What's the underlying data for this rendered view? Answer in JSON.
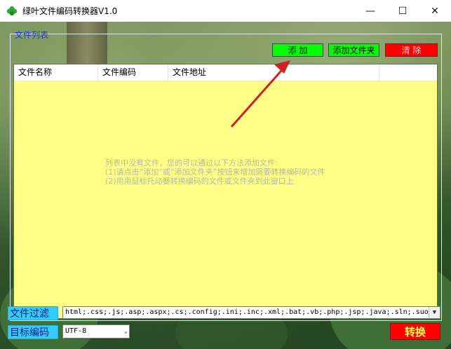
{
  "window": {
    "title": "绿叶文件编码转换器V1.0",
    "controls": {
      "minimize": "—",
      "maximize": "☐",
      "close": "✕"
    }
  },
  "file_list": {
    "group_label": "文件列表",
    "buttons": {
      "add": "添 加",
      "add_folder": "添加文件夹",
      "clear": "清 除"
    },
    "columns": [
      "文件名称",
      "文件编码",
      "文件地址",
      ""
    ],
    "empty_hint": [
      "列表中没有文件，您的可以通过以下方法添加文件:",
      "(1)请点击“添加”或“添加文件夹”按钮来增加需要转换编码的文件",
      "(2)用用鼠标托动要转换编码的文件或文件夹到此窗口上"
    ]
  },
  "filter": {
    "label": "文件过滤",
    "value": "html;.css;.js;.asp;.aspx;.cs;.config;.ini;.inc;.xml;.bat;.vb;.php;.jsp;.java;.sln;.suo"
  },
  "target_encoding": {
    "label": "目标编码",
    "selected": "UTF-8"
  },
  "convert_button": "转换",
  "colors": {
    "add_button": "#00ff00",
    "clear_button": "#ff0000",
    "list_background": "#ffff88",
    "label_background": "#33ccff",
    "annotation_arrow": "#cc2222"
  }
}
